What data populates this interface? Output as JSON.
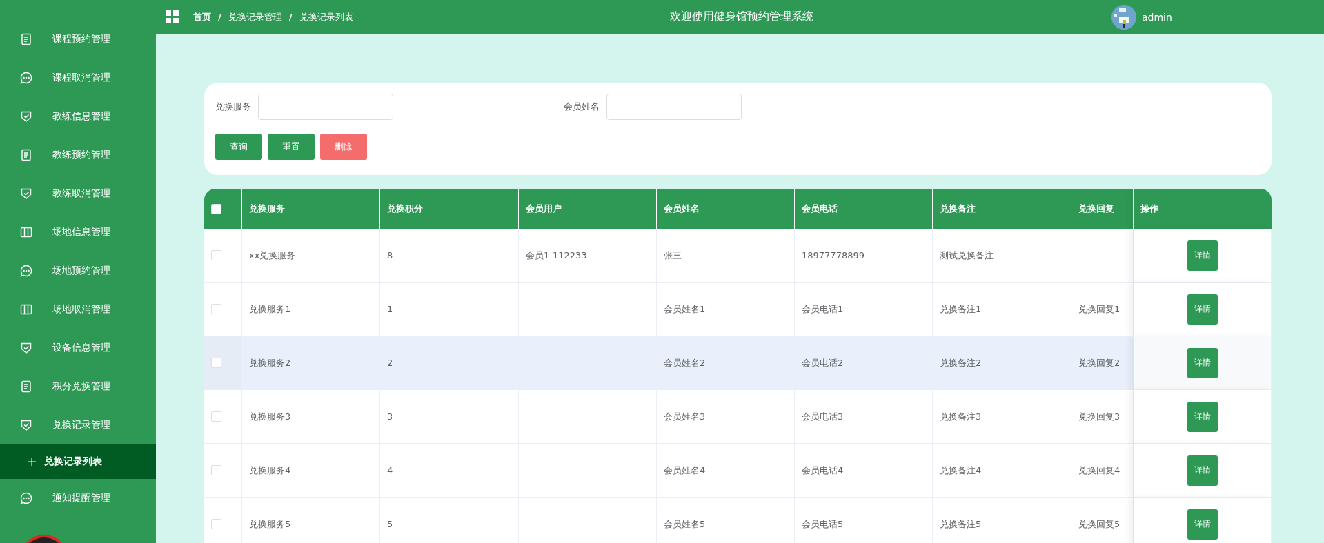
{
  "sidebar": {
    "items": [
      {
        "label": "课程预约管理",
        "kind": "document",
        "selected": false
      },
      {
        "label": "课程取消管理",
        "kind": "chat",
        "selected": false
      },
      {
        "label": "教练信息管理",
        "kind": "shield",
        "selected": false
      },
      {
        "label": "教练预约管理",
        "kind": "document",
        "selected": false
      },
      {
        "label": "教练取消管理",
        "kind": "shield",
        "selected": false
      },
      {
        "label": "场地信息管理",
        "kind": "columns",
        "selected": false
      },
      {
        "label": "场地预约管理",
        "kind": "chat",
        "selected": false
      },
      {
        "label": "场地取消管理",
        "kind": "columns",
        "selected": false
      },
      {
        "label": "设备信息管理",
        "kind": "shield",
        "selected": false
      },
      {
        "label": "积分兑换管理",
        "kind": "document",
        "selected": false
      },
      {
        "label": "兑换记录管理",
        "kind": "shield",
        "selected": false,
        "children": [
          {
            "label": "兑换记录列表",
            "selected": true
          }
        ]
      },
      {
        "label": "通知提醒管理",
        "kind": "chat",
        "selected": false
      }
    ]
  },
  "breadcrumb": [
    "首页",
    "兑换记录管理",
    "兑换记录列表"
  ],
  "breadcrumb_separator": "/",
  "header": {
    "title": "欢迎使用健身馆预约管理系统",
    "user": "admin"
  },
  "search": {
    "fields": [
      {
        "label": "兑换服务"
      },
      {
        "label": "会员姓名"
      }
    ],
    "buttons": [
      {
        "label": "查询",
        "kind": "primary"
      },
      {
        "label": "重置",
        "kind": "primary"
      },
      {
        "label": "删除",
        "kind": "danger"
      }
    ]
  },
  "table": {
    "select_all_checked": false,
    "columns": [
      "兑换服务",
      "兑换积分",
      "会员用户",
      "会员姓名",
      "会员电话",
      "兑换备注",
      "兑换回复",
      "操作"
    ],
    "rows": [
      {
        "checked": false,
        "highlighted": false,
        "cells": [
          "xx兑换服务",
          "8",
          "会员1-112233",
          "张三",
          "18977778899",
          "测试兑换备注",
          ""
        ],
        "action": "详情"
      },
      {
        "checked": false,
        "highlighted": false,
        "cells": [
          "兑换服务1",
          "1",
          "",
          "会员姓名1",
          "会员电话1",
          "兑换备注1",
          "兑换回复1"
        ],
        "action": "详情"
      },
      {
        "checked": false,
        "highlighted": true,
        "cells": [
          "兑换服务2",
          "2",
          "",
          "会员姓名2",
          "会员电话2",
          "兑换备注2",
          "兑换回复2"
        ],
        "action": "详情"
      },
      {
        "checked": false,
        "highlighted": false,
        "cells": [
          "兑换服务3",
          "3",
          "",
          "会员姓名3",
          "会员电话3",
          "兑换备注3",
          "兑换回复3"
        ],
        "action": "详情"
      },
      {
        "checked": false,
        "highlighted": false,
        "cells": [
          "兑换服务4",
          "4",
          "",
          "会员姓名4",
          "会员电话4",
          "兑换备注4",
          "兑换回复4"
        ],
        "action": "详情"
      },
      {
        "checked": false,
        "highlighted": false,
        "cells": [
          "兑换服务5",
          "5",
          "",
          "会员姓名5",
          "会员电话5",
          "兑换备注5",
          "兑换回复5"
        ],
        "action": "详情"
      }
    ]
  }
}
